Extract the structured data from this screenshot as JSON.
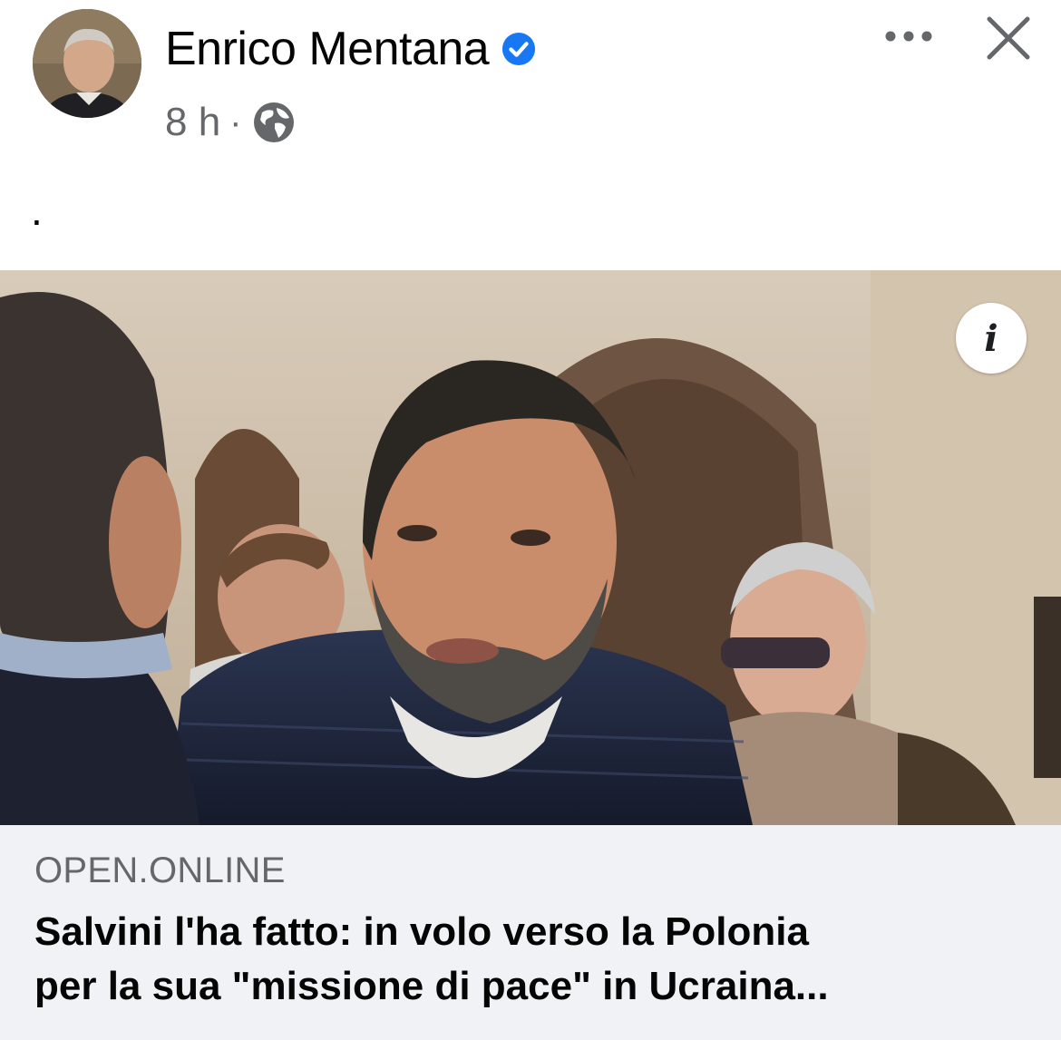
{
  "post": {
    "author": "Enrico Mentana",
    "verified_icon": "verified-badge-icon",
    "timestamp": "8 h",
    "separator": "·",
    "audience_icon": "globe-icon",
    "more_icon": "more-options-icon",
    "close_icon": "close-icon",
    "text": "."
  },
  "link_preview": {
    "info_icon": "info-icon",
    "info_glyph": "i",
    "domain": "OPEN.ONLINE",
    "title_line1": "Salvini l'ha fatto: in volo verso la Polonia",
    "title_line2": "per la sua \"missione di pace\" in Ucraina..."
  },
  "colors": {
    "text_primary": "#050505",
    "text_secondary": "#65676b",
    "verified_blue": "#1877f2",
    "footer_bg": "#f0f2f5"
  }
}
